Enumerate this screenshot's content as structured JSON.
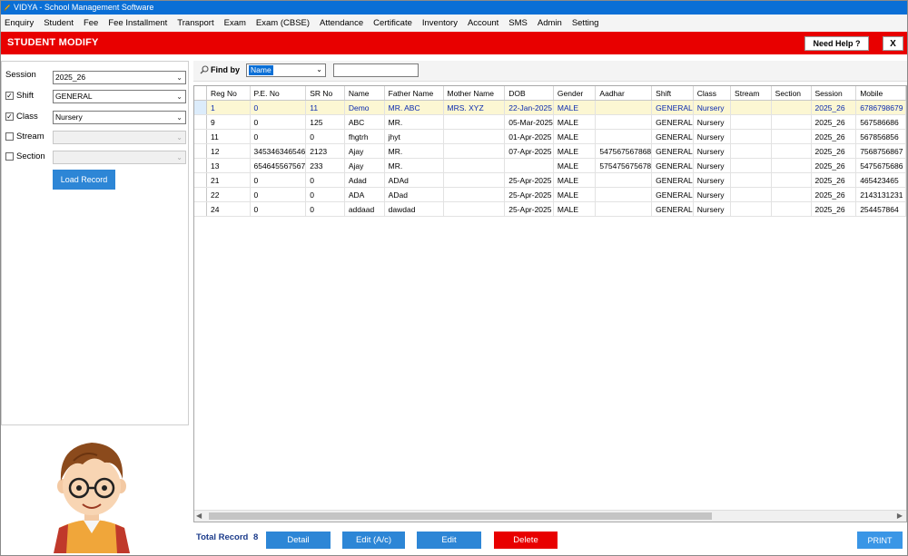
{
  "window": {
    "title": "VIDYA - School Management Software"
  },
  "menu": [
    "Enquiry",
    "Student",
    "Fee",
    "Fee Installment",
    "Transport",
    "Exam",
    "Exam (CBSE)",
    "Attendance",
    "Certificate",
    "Inventory",
    "Account",
    "SMS",
    "Admin",
    "Setting"
  ],
  "header": {
    "title": "STUDENT MODIFY",
    "help_label": "Need Help ?",
    "close_label": "X"
  },
  "filters": {
    "session": {
      "label": "Session",
      "value": "2025_26"
    },
    "shift": {
      "label": "Shift",
      "value": "GENERAL",
      "checked": true
    },
    "class": {
      "label": "Class",
      "value": "Nursery",
      "checked": true
    },
    "stream": {
      "label": "Stream",
      "value": "",
      "checked": false
    },
    "section": {
      "label": "Section",
      "value": "",
      "checked": false
    },
    "load_label": "Load Record"
  },
  "search": {
    "label": "Find by",
    "field": "Name",
    "value": ""
  },
  "table": {
    "columns": [
      "Reg No",
      "P.E. No",
      "SR No",
      "Name",
      "Father Name",
      "Mother Name",
      "DOB",
      "Gender",
      "Aadhar",
      "Shift",
      "Class",
      "Stream",
      "Section",
      "Session",
      "Mobile"
    ],
    "rows": [
      [
        "1",
        "0",
        "11",
        "Demo",
        "MR. ABC",
        "MRS. XYZ",
        "22-Jan-2025",
        "MALE",
        "",
        "GENERAL",
        "Nursery",
        "",
        "",
        "2025_26",
        "6786798679"
      ],
      [
        "9",
        "0",
        "125",
        "ABC",
        "MR.",
        "",
        "05-Mar-2025",
        "MALE",
        "",
        "GENERAL",
        "Nursery",
        "",
        "",
        "2025_26",
        "567586686"
      ],
      [
        "11",
        "0",
        "0",
        "fhgtrh",
        "jhyt",
        "",
        "01-Apr-2025",
        "MALE",
        "",
        "GENERAL",
        "Nursery",
        "",
        "",
        "2025_26",
        "567856856"
      ],
      [
        "12",
        "345346346546",
        "2123",
        "Ajay",
        "MR.",
        "",
        "07-Apr-2025",
        "MALE",
        "547567567868",
        "GENERAL",
        "Nursery",
        "",
        "",
        "2025_26",
        "7568756867"
      ],
      [
        "13",
        "654645567567",
        "233",
        "Ajay",
        "MR.",
        "",
        "",
        "MALE",
        "575475675678",
        "GENERAL",
        "Nursery",
        "",
        "",
        "2025_26",
        "5475675686"
      ],
      [
        "21",
        "0",
        "0",
        "Adad",
        "ADAd",
        "",
        "25-Apr-2025",
        "MALE",
        "",
        "GENERAL",
        "Nursery",
        "",
        "",
        "2025_26",
        "465423465"
      ],
      [
        "22",
        "0",
        "0",
        "ADA",
        "ADad",
        "",
        "25-Apr-2025",
        "MALE",
        "",
        "GENERAL",
        "Nursery",
        "",
        "",
        "2025_26",
        "2143131231"
      ],
      [
        "24",
        "0",
        "0",
        "addaad",
        "dawdad",
        "",
        "25-Apr-2025",
        "MALE",
        "",
        "GENERAL",
        "Nursery",
        "",
        "",
        "2025_26",
        "254457864"
      ]
    ]
  },
  "footer": {
    "total_label": "Total Record",
    "total_count": "8",
    "detail_label": "Detail",
    "edit_ac_label": "Edit (A/c)",
    "edit_label": "Edit",
    "delete_label": "Delete",
    "print_label": "PRINT"
  },
  "colors": {
    "accent": "#e80000",
    "button": "#2d86d6",
    "titlebar": "#0a6fd6",
    "selected_row": "#fcf7d3"
  },
  "icons": {
    "app": "pencil-icon",
    "find": "magnifier-icon",
    "avatar": "student-cartoon"
  }
}
